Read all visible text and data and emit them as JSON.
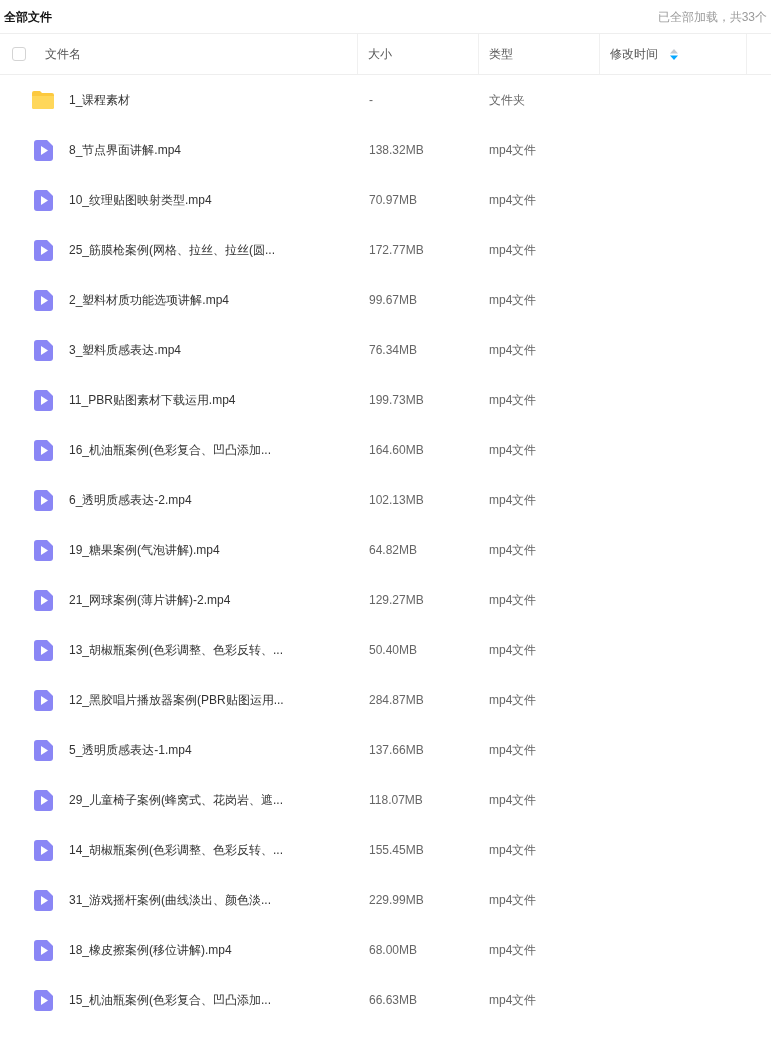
{
  "header": {
    "title": "全部文件",
    "status": "已全部加载，共33个"
  },
  "table": {
    "select_all": {
      "checked": false
    },
    "columns": [
      {
        "label": "文件名"
      },
      {
        "label": "大小"
      },
      {
        "label": "类型"
      },
      {
        "label": "修改时间",
        "sorted_descending": true
      }
    ],
    "rows": [
      {
        "kind": "folder",
        "name": "1_课程素材",
        "size": "-",
        "type": "文件夹"
      },
      {
        "kind": "video",
        "name": "8_节点界面讲解.mp4",
        "size": "138.32MB",
        "type": "mp4文件"
      },
      {
        "kind": "video",
        "name": "10_纹理贴图映射类型.mp4",
        "size": "70.97MB",
        "type": "mp4文件"
      },
      {
        "kind": "video",
        "name": "25_筋膜枪案例(网格、拉丝、拉丝(圆...",
        "size": "172.77MB",
        "type": "mp4文件"
      },
      {
        "kind": "video",
        "name": "2_塑料材质功能选项讲解.mp4",
        "size": "99.67MB",
        "type": "mp4文件"
      },
      {
        "kind": "video",
        "name": "3_塑料质感表达.mp4",
        "size": "76.34MB",
        "type": "mp4文件"
      },
      {
        "kind": "video",
        "name": "11_PBR贴图素材下载运用.mp4",
        "size": "199.73MB",
        "type": "mp4文件"
      },
      {
        "kind": "video",
        "name": "16_机油瓶案例(色彩复合、凹凸添加...",
        "size": "164.60MB",
        "type": "mp4文件"
      },
      {
        "kind": "video",
        "name": "6_透明质感表达-2.mp4",
        "size": "102.13MB",
        "type": "mp4文件"
      },
      {
        "kind": "video",
        "name": "19_糖果案例(气泡讲解).mp4",
        "size": "64.82MB",
        "type": "mp4文件"
      },
      {
        "kind": "video",
        "name": "21_网球案例(薄片讲解)-2.mp4",
        "size": "129.27MB",
        "type": "mp4文件"
      },
      {
        "kind": "video",
        "name": "13_胡椒瓶案例(色彩调整、色彩反转、...",
        "size": "50.40MB",
        "type": "mp4文件"
      },
      {
        "kind": "video",
        "name": "12_黑胶唱片播放器案例(PBR贴图运用...",
        "size": "284.87MB",
        "type": "mp4文件"
      },
      {
        "kind": "video",
        "name": "5_透明质感表达-1.mp4",
        "size": "137.66MB",
        "type": "mp4文件"
      },
      {
        "kind": "video",
        "name": "29_儿童椅子案例(蜂窝式、花岗岩、遮...",
        "size": "118.07MB",
        "type": "mp4文件"
      },
      {
        "kind": "video",
        "name": "14_胡椒瓶案例(色彩调整、色彩反转、...",
        "size": "155.45MB",
        "type": "mp4文件"
      },
      {
        "kind": "video",
        "name": "31_游戏摇杆案例(曲线淡出、颜色淡...",
        "size": "229.99MB",
        "type": "mp4文件"
      },
      {
        "kind": "video",
        "name": "18_橡皮擦案例(移位讲解).mp4",
        "size": "68.00MB",
        "type": "mp4文件"
      },
      {
        "kind": "video",
        "name": "15_机油瓶案例(色彩复合、凹凸添加...",
        "size": "66.63MB",
        "type": "mp4文件"
      }
    ]
  }
}
